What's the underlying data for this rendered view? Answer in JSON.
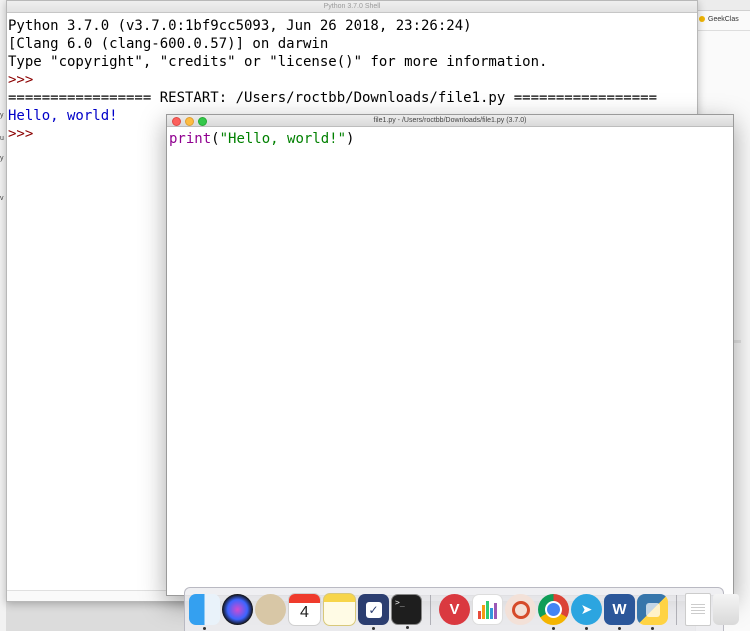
{
  "shell": {
    "title": "Python 3.7.0 Shell",
    "lines": [
      "Python 3.7.0 (v3.7.0:1bf9cc5093, Jun 26 2018, 23:26:24)",
      "[Clang 6.0 (clang-600.0.57)] on darwin",
      "Type \"copyright\", \"credits\" or \"license()\" for more information.",
      ">>> ",
      "================= RESTART: /Users/roctbb/Downloads/file1.py =================",
      "Hello, world!",
      ">>> "
    ]
  },
  "editor": {
    "title": "file1.py - /Users/roctbb/Downloads/file1.py (3.7.0)",
    "code": {
      "keyword": "print",
      "open": "(",
      "string": "\"Hello, world!\"",
      "close": ")"
    }
  },
  "background_window": {
    "tab_label": "GeekClas"
  },
  "left_fragments": [
    "y",
    "u",
    "y",
    "v"
  ],
  "dock": {
    "calendar_month": "JUL",
    "calendar_day": "4",
    "terminal_prompt": ">_",
    "vpn_letter": "V",
    "word_letter": "W",
    "telegram_glyph": "➤",
    "tasks_glyph": "✓",
    "apps": [
      "finder",
      "siri",
      "launchpad",
      "calendar",
      "notes",
      "tasks",
      "terminal",
      "expressvpn",
      "istat",
      "scrobbles",
      "chrome",
      "telegram",
      "word",
      "python",
      "document",
      "trash"
    ]
  },
  "colors": {
    "keyword": "#900090",
    "string": "#008000",
    "output": "#0000c8",
    "prompt": "#8b0000"
  }
}
